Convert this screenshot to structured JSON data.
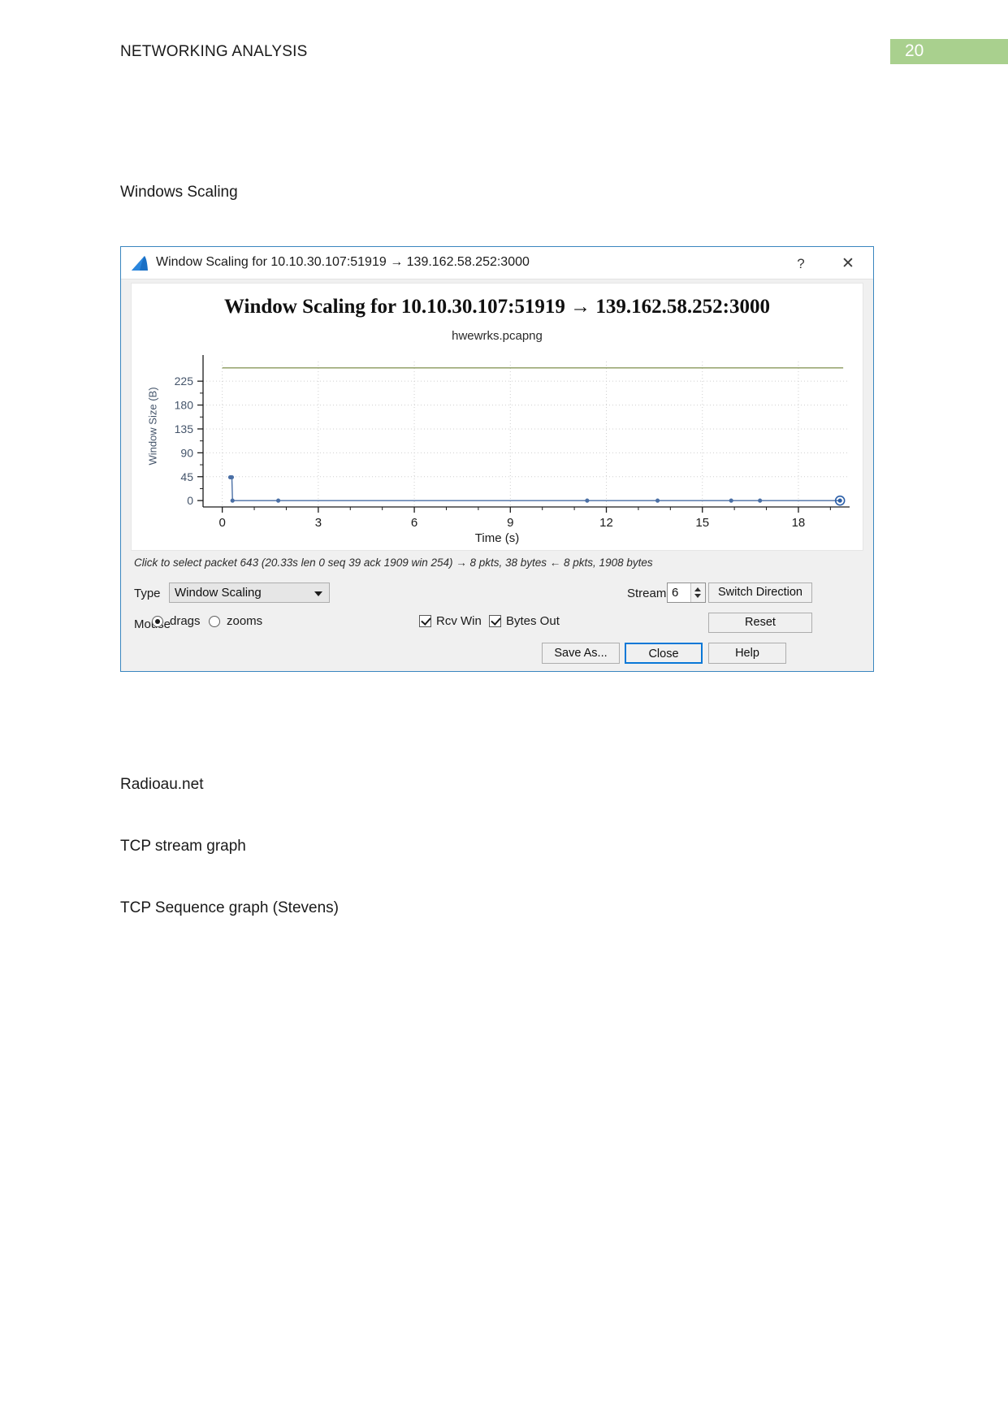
{
  "document": {
    "header_title": "NETWORKING ANALYSIS",
    "page_number": "20",
    "page_badge_color": "#a9d08e",
    "paragraphs": {
      "windows_scaling": "Windows Scaling",
      "radioau": "Radioau.net",
      "tcp_stream_graph": "TCP stream graph",
      "tcp_sequence_graph": "TCP Sequence graph (Stevens)"
    }
  },
  "dialog": {
    "titlebar": {
      "icon": "wireshark-shark-fin-icon",
      "title": "Window Scaling for 10.10.30.107:51919 → 139.162.58.252:3000",
      "help_label": "?",
      "close_label": "✕"
    },
    "hint_text": "Click to select packet 643 (20.33s len 0 seq 39 ack 1909 win 254) → 8 pkts, 38 bytes ← 8 pkts, 1908 bytes",
    "controls": {
      "type_label": "Type",
      "type_value": "Window Scaling",
      "mouse_label": "Mouse",
      "mouse_options": [
        {
          "label": "drags",
          "selected": true
        },
        {
          "label": "zooms",
          "selected": false
        }
      ],
      "checkboxes": [
        {
          "label": "Rcv Win",
          "checked": true
        },
        {
          "label": "Bytes Out",
          "checked": true
        }
      ],
      "stream_label": "Stream",
      "stream_value": "6",
      "switch_direction_label": "Switch Direction",
      "reset_label": "Reset",
      "save_as_label": "Save As...",
      "close_label": "Close",
      "help_label": "Help"
    }
  },
  "chart_data": {
    "type": "line",
    "title": "Window Scaling for 10.10.30.107:51919 → 139.162.58.252:3000",
    "subtitle": "hwewrks.pcapng",
    "xlabel": "Time (s)",
    "ylabel": "Window Size (B)",
    "xlim": [
      -0.6,
      19.6
    ],
    "ylim": [
      -12,
      262
    ],
    "xticks": [
      0,
      3,
      6,
      9,
      12,
      15,
      18
    ],
    "yticks": [
      0,
      45,
      90,
      135,
      180,
      225
    ],
    "grid": true,
    "legend": "none",
    "series": [
      {
        "name": "Rcv Win",
        "color": "#8a9a5b",
        "type": "line",
        "x": [
          0.0,
          19.4
        ],
        "y": [
          250,
          250
        ]
      },
      {
        "name": "Bytes Out",
        "color": "#4a6fa5",
        "type": "line-markers",
        "x": [
          0.25,
          0.3,
          0.32,
          1.75,
          11.4,
          13.6,
          15.9,
          16.8,
          19.3
        ],
        "y": [
          44,
          44,
          0,
          0,
          0,
          0,
          0,
          0,
          0
        ]
      }
    ],
    "selected_point": {
      "x": 19.3,
      "y": 0
    }
  }
}
